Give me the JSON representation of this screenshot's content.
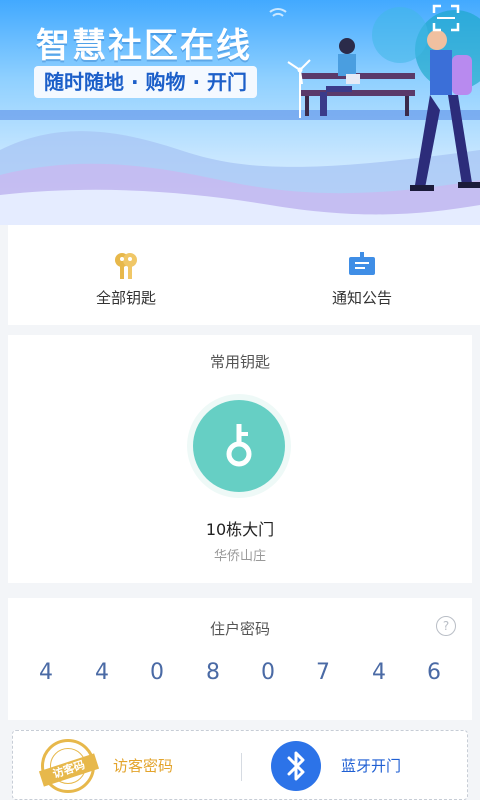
{
  "banner": {
    "title": "智慧社区在线",
    "subtitle": "随时随地 · 购物 · 开门",
    "scan_icon": "scan-icon"
  },
  "quick_actions": [
    {
      "label": "全部钥匙",
      "icon": "keys-icon",
      "color": "#e7b84b"
    },
    {
      "label": "通知公告",
      "icon": "notice-board-icon",
      "color": "#3f8ee6"
    }
  ],
  "common_key": {
    "section_title": "常用钥匙",
    "name": "10栋大门",
    "community": "华侨山庄",
    "icon": "key-icon",
    "color": "#66cfc4"
  },
  "resident_pin": {
    "section_title": "住户密码",
    "help_icon": "help-icon",
    "help_glyph": "?",
    "digits": [
      "4",
      "4",
      "0",
      "8",
      "0",
      "7",
      "4",
      "6"
    ]
  },
  "bottom_actions": {
    "visitor": {
      "label": "访客密码",
      "stamp_text": "访客码",
      "icon": "visitor-stamp-icon",
      "color": "#e3a42c"
    },
    "bluetooth": {
      "label": "蓝牙开门",
      "icon": "bluetooth-icon",
      "color": "#2c73e8"
    }
  }
}
